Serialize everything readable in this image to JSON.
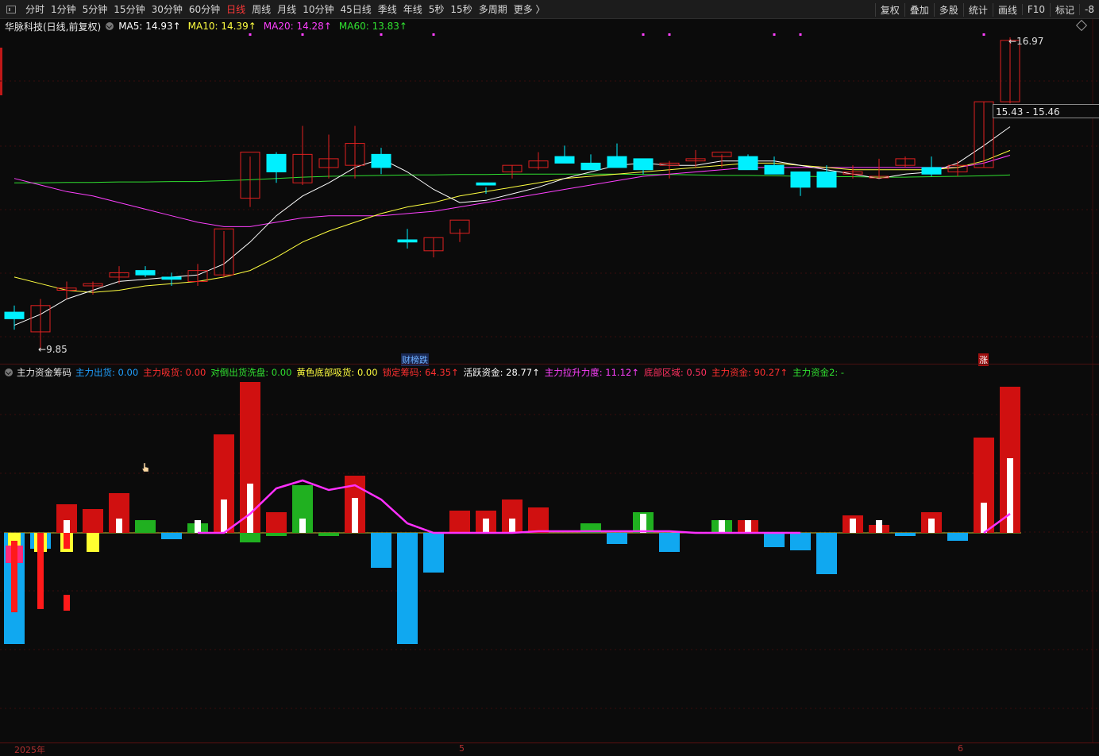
{
  "toolbar": {
    "periods": [
      "分时",
      "1分钟",
      "5分钟",
      "15分钟",
      "30分钟",
      "60分钟",
      "日线",
      "周线",
      "月线",
      "10分钟",
      "45日线",
      "季线",
      "年线",
      "5秒",
      "15秒",
      "多周期",
      "更多 〉"
    ],
    "active_period": "日线",
    "right_tools": [
      "复权",
      "叠加",
      "多股",
      "统计",
      "画线",
      "F10",
      "标记",
      "-8"
    ]
  },
  "main_chart": {
    "stock": "华脉科技(日线,前复权)",
    "ma": [
      {
        "label": "MA5: 14.93↑",
        "color": "#ffffff"
      },
      {
        "label": "MA10: 14.39↑",
        "color": "#ffff40"
      },
      {
        "label": "MA20: 14.28↑",
        "color": "#ff40ff"
      },
      {
        "label": "MA60: 13.83↑",
        "color": "#30e030"
      }
    ],
    "high_label": "16.97",
    "low_label": "9.85",
    "price_box": "15.43 - 15.46",
    "tag_bottom": "财榜跌",
    "tag_right": "涨"
  },
  "indicator": {
    "name": "主力资金筹码",
    "values": [
      {
        "label": "主力出货: 0.00",
        "color": "#20a0ff"
      },
      {
        "label": "主力吸货: 0.00",
        "color": "#ff3030"
      },
      {
        "label": "对倒出货洗盘: 0.00",
        "color": "#30e030"
      },
      {
        "label": "黄色底部吸货: 0.00",
        "color": "#ffff40"
      },
      {
        "label": "锁定筹码: 64.35↑",
        "color": "#ff3030"
      },
      {
        "label": "活跃资金: 28.77↑",
        "color": "#ffffff"
      },
      {
        "label": "主力拉升力度: 11.12↑",
        "color": "#ff40ff"
      },
      {
        "label": "底部区域: 0.50",
        "color": "#ff3060"
      },
      {
        "label": "主力资金: 90.27↑",
        "color": "#ff3030"
      },
      {
        "label": "主力资金2: -",
        "color": "#30e030"
      }
    ]
  },
  "x_axis": [
    "2025年",
    "5",
    "6"
  ],
  "colors": {
    "up": "#e02020",
    "down": "#00f0ff",
    "ma5": "#ffffff",
    "ma10": "#ffff40",
    "ma20": "#ff40ff",
    "ma60": "#30e030"
  },
  "chart_data": {
    "type": "candlestick",
    "candles": [
      [
        10.7,
        10.85,
        10.3,
        10.55
      ],
      [
        10.25,
        11.0,
        9.85,
        10.85
      ],
      [
        11.2,
        11.4,
        11.0,
        11.25
      ],
      [
        11.3,
        11.4,
        11.1,
        11.35
      ],
      [
        11.5,
        11.75,
        11.35,
        11.6
      ],
      [
        11.65,
        11.75,
        11.5,
        11.55
      ],
      [
        11.5,
        11.6,
        11.3,
        11.45
      ],
      [
        11.4,
        11.8,
        11.3,
        11.65
      ],
      [
        11.55,
        12.55,
        11.5,
        12.6
      ],
      [
        13.3,
        14.25,
        13.1,
        14.35
      ],
      [
        14.3,
        14.35,
        13.65,
        13.9
      ],
      [
        13.65,
        14.95,
        13.6,
        14.3
      ],
      [
        14.0,
        14.75,
        13.75,
        14.2
      ],
      [
        14.05,
        14.95,
        13.75,
        14.55
      ],
      [
        14.3,
        14.45,
        13.85,
        14.0
      ],
      [
        12.35,
        12.6,
        12.15,
        12.3
      ],
      [
        12.1,
        12.4,
        11.95,
        12.4
      ],
      [
        12.5,
        12.6,
        12.3,
        12.8
      ],
      [
        13.65,
        13.55,
        13.4,
        13.6
      ],
      [
        13.9,
        14.05,
        13.75,
        14.05
      ],
      [
        14.0,
        14.35,
        13.95,
        14.15
      ],
      [
        14.25,
        14.5,
        14.1,
        14.1
      ],
      [
        14.1,
        14.3,
        13.95,
        13.95
      ],
      [
        14.25,
        14.55,
        14.2,
        14.0
      ],
      [
        14.2,
        14.15,
        13.85,
        13.95
      ],
      [
        14.05,
        14.15,
        13.75,
        14.1
      ],
      [
        14.15,
        14.4,
        14.0,
        14.2
      ],
      [
        14.25,
        14.3,
        14.0,
        14.35
      ],
      [
        14.25,
        14.3,
        14.05,
        13.95
      ],
      [
        14.05,
        14.25,
        13.9,
        13.85
      ],
      [
        13.9,
        13.9,
        13.35,
        13.55
      ],
      [
        13.9,
        14.05,
        13.7,
        13.55
      ],
      [
        13.85,
        14.05,
        13.75,
        13.9
      ],
      [
        13.8,
        14.2,
        13.75,
        13.8
      ],
      [
        14.05,
        14.25,
        14.0,
        14.2
      ],
      [
        14.0,
        14.25,
        13.8,
        13.85
      ],
      [
        13.9,
        14.15,
        13.8,
        14.05
      ],
      [
        14.0,
        15.5,
        14.0,
        15.5
      ],
      [
        15.5,
        16.97,
        15.46,
        16.9
      ]
    ],
    "ma5": [
      10.4,
      10.65,
      11.0,
      11.2,
      11.4,
      11.45,
      11.5,
      11.55,
      11.8,
      12.3,
      12.9,
      13.35,
      13.65,
      14.0,
      14.2,
      13.9,
      13.5,
      13.2,
      13.25,
      13.4,
      13.55,
      13.75,
      13.9,
      14.05,
      14.1,
      14.05,
      14.05,
      14.15,
      14.15,
      14.15,
      14.05,
      13.95,
      13.85,
      13.75,
      13.85,
      13.9,
      14.1,
      14.5,
      14.93
    ],
    "ma10": [
      11.5,
      11.35,
      11.2,
      11.15,
      11.2,
      11.3,
      11.35,
      11.4,
      11.5,
      11.65,
      11.95,
      12.3,
      12.55,
      12.75,
      12.95,
      13.1,
      13.2,
      13.35,
      13.45,
      13.55,
      13.65,
      13.75,
      13.8,
      13.85,
      13.9,
      13.95,
      14.0,
      14.05,
      14.1,
      14.1,
      14.05,
      14.0,
      13.95,
      13.95,
      13.95,
      13.95,
      14.0,
      14.15,
      14.39
    ],
    "ma20": [
      13.75,
      13.6,
      13.45,
      13.35,
      13.2,
      13.05,
      12.9,
      12.75,
      12.65,
      12.65,
      12.75,
      12.85,
      12.9,
      12.9,
      12.9,
      12.95,
      13.0,
      13.1,
      13.2,
      13.3,
      13.4,
      13.5,
      13.6,
      13.7,
      13.8,
      13.85,
      13.9,
      13.95,
      14.0,
      14.0,
      14.0,
      14.0,
      14.0,
      14.0,
      14.0,
      14.0,
      14.0,
      14.1,
      14.28
    ],
    "ma60": [
      13.65,
      13.65,
      13.66,
      13.66,
      13.67,
      13.67,
      13.68,
      13.68,
      13.7,
      13.72,
      13.75,
      13.78,
      13.8,
      13.81,
      13.82,
      13.83,
      13.83,
      13.84,
      13.84,
      13.85,
      13.85,
      13.85,
      13.85,
      13.85,
      13.84,
      13.84,
      13.83,
      13.82,
      13.82,
      13.81,
      13.8,
      13.79,
      13.79,
      13.78,
      13.78,
      13.79,
      13.8,
      13.81,
      13.83
    ],
    "indicator_bars": [
      {
        "main": -70,
        "lock": 0,
        "yellow": -12,
        "blue": -70,
        "pink": true
      },
      {
        "main": 0,
        "lock": 0,
        "yellow": -12,
        "blue": -10,
        "red_small": -48
      },
      {
        "main": 18,
        "lock": 8,
        "yellow": -12,
        "red_small": -10
      },
      {
        "main": 15,
        "lock": 0,
        "yellow": -12
      },
      {
        "main": 25,
        "lock": 9
      },
      {
        "green": 8
      },
      {
        "blue": -4
      },
      {
        "green": 6,
        "lock": 8
      },
      {
        "main": 62,
        "lock": 21
      },
      {
        "main": 95,
        "lock": 31,
        "green": -6
      },
      {
        "main": 13,
        "green": -2
      },
      {
        "green": 30,
        "lock": 9
      },
      {
        "green": -2
      },
      {
        "main": 36,
        "lock": 22
      },
      {
        "blue": -22
      },
      {
        "blue": -70
      },
      {
        "blue": -25
      },
      {
        "main": 14
      },
      {
        "main": 14,
        "lock": 9
      },
      {
        "main": 21,
        "lock": 9
      },
      {
        "main": 16
      },
      {},
      {
        "green": 6
      },
      {
        "blue": -7
      },
      {
        "green": 13,
        "lock": 12
      },
      {
        "blue": -12
      },
      {},
      {
        "green": 8,
        "lock": 8
      },
      {
        "main": 8,
        "lock": 8
      },
      {
        "blue": -9
      },
      {
        "blue": -11
      },
      {
        "blue": -26
      },
      {
        "main": 11,
        "lock": 9
      },
      {
        "main": 5,
        "lock": 8
      },
      {
        "blue": -2
      },
      {
        "main": 13,
        "lock": 9
      },
      {
        "blue": -5
      },
      {
        "main": 60,
        "lock": 19
      },
      {
        "main": 92,
        "lock": 47
      }
    ],
    "lift_line": [
      null,
      null,
      null,
      null,
      null,
      null,
      null,
      0,
      0,
      12,
      28,
      33,
      27,
      30,
      21,
      6,
      0,
      0,
      0,
      0,
      1,
      1,
      1,
      1,
      1,
      1,
      0,
      0,
      0,
      0,
      0,
      null,
      null,
      null,
      null,
      null,
      null,
      0,
      12
    ]
  }
}
